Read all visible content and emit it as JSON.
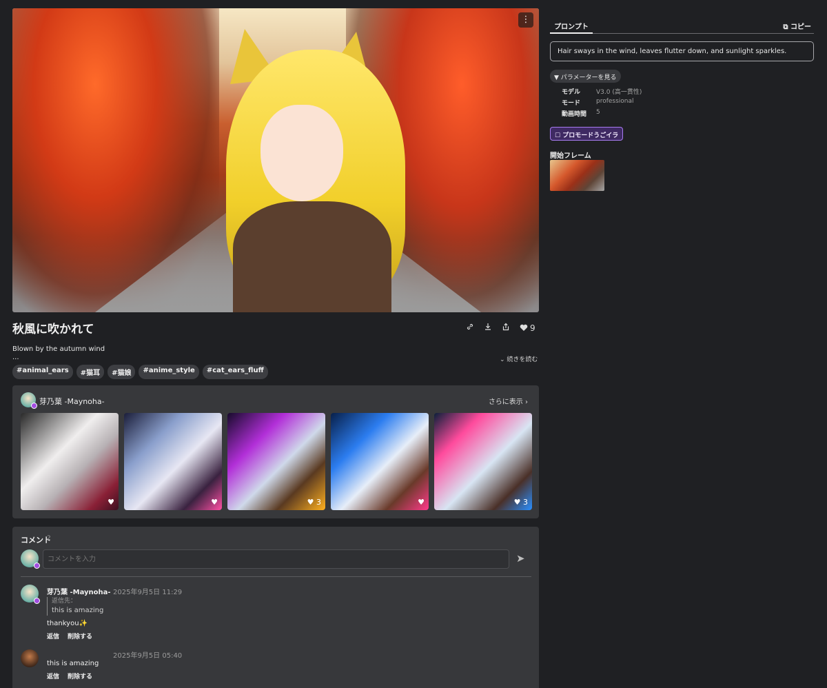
{
  "hero": {
    "menu_icon": "⋮"
  },
  "post": {
    "title": "秋風に吹かれて",
    "description": "Blown by the autumn wind",
    "ellipsis": "...",
    "read_more": "⌄ 続きを読む",
    "like_count": "9",
    "tags": [
      "#animal_ears",
      "#猫耳",
      "#猫娘",
      "#anime_style",
      "#cat_ears_fluff"
    ],
    "icons": [
      "link-icon",
      "download-icon",
      "share-icon",
      "heart-icon"
    ]
  },
  "creator": {
    "name": "芽乃葉 -Maynoha-",
    "more": "さらに表示 ›",
    "thumbs": [
      {
        "likes": ""
      },
      {
        "likes": ""
      },
      {
        "likes": "3"
      },
      {
        "likes": ""
      },
      {
        "likes": "3"
      }
    ]
  },
  "comments": {
    "heading": "コメント",
    "count": "2",
    "input_placeholder": "コメントを入力",
    "items": [
      {
        "author": "芽乃葉 -Maynoha-",
        "time": "2025年9月5日 11:29",
        "reply_label": "返信先：",
        "reply_text": "this is amazing",
        "text": "thankyou✨",
        "reply": "返信",
        "delete": "削除する"
      },
      {
        "author": "",
        "time": "2025年9月5日 05:40",
        "text": "this is amazing",
        "reply": "返信",
        "delete": "削除する"
      }
    ]
  },
  "sidebar": {
    "tab": "プロンプト",
    "copy": "コピー",
    "prompt": "Hair sways in the wind, leaves flutter down, and sunlight sparkles.",
    "params_button": "▼ パラメーターを見る",
    "params": [
      {
        "key": "モデル",
        "value": "V3.0 (高一貫性)"
      },
      {
        "key": "モード",
        "value": "professional"
      },
      {
        "key": "動画時間",
        "value": "5"
      }
    ],
    "promo_button": "プロモードうごイラ",
    "start_frame_label": "開始フレーム"
  },
  "colors": {
    "background": "#1f2023",
    "panel": "#37383b",
    "accent": "#a97cf2"
  }
}
